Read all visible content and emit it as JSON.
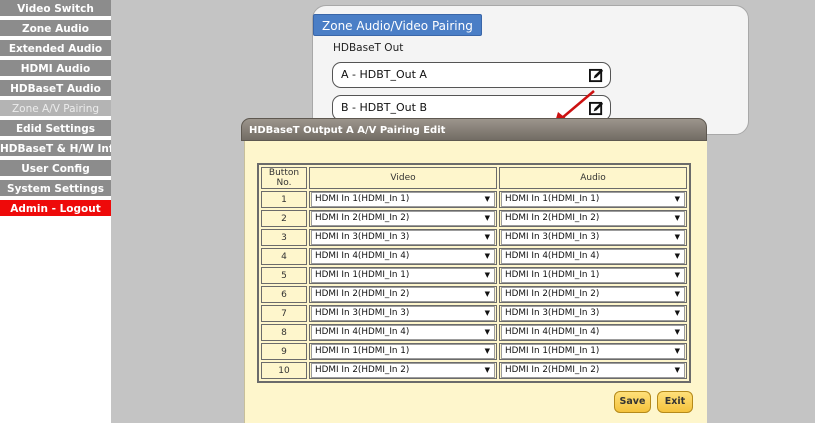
{
  "sidebar": {
    "items": [
      {
        "label": "Video Switch",
        "state": "normal"
      },
      {
        "label": "Zone Audio",
        "state": "normal"
      },
      {
        "label": "Extended Audio",
        "state": "normal"
      },
      {
        "label": "HDMI Audio",
        "state": "normal"
      },
      {
        "label": "HDBaseT Audio",
        "state": "normal"
      },
      {
        "label": "Zone A/V Pairing",
        "state": "active"
      },
      {
        "label": "Edid Settings",
        "state": "normal"
      },
      {
        "label": "HDBaseT & H/W Info",
        "state": "normal"
      },
      {
        "label": "User Config",
        "state": "normal"
      },
      {
        "label": "System Settings",
        "state": "normal"
      },
      {
        "label": "Admin - Logout",
        "state": "logout"
      }
    ]
  },
  "zone": {
    "title": "Zone Audio/Video Pairing",
    "subtitle": "HDBaseT Out",
    "outputs": [
      {
        "label": "A - HDBT_Out A",
        "icon": "edit-icon"
      },
      {
        "label": "B - HDBT_Out B",
        "icon": "edit-icon"
      }
    ]
  },
  "dialog": {
    "title": "HDBaseT Output A A/V Pairing Edit",
    "columns": {
      "button_no": "Button No.",
      "video": "Video",
      "audio": "Audio"
    },
    "rows": [
      {
        "no": "1",
        "video": "HDMI In 1(HDMI_In 1)",
        "audio": "HDMI In 1(HDMI_In 1)"
      },
      {
        "no": "2",
        "video": "HDMI In 2(HDMI_In 2)",
        "audio": "HDMI In 2(HDMI_In 2)"
      },
      {
        "no": "3",
        "video": "HDMI In 3(HDMI_In 3)",
        "audio": "HDMI In 3(HDMI_In 3)"
      },
      {
        "no": "4",
        "video": "HDMI In 4(HDMI_In 4)",
        "audio": "HDMI In 4(HDMI_In 4)"
      },
      {
        "no": "5",
        "video": "HDMI In 1(HDMI_In 1)",
        "audio": "HDMI In 1(HDMI_In 1)"
      },
      {
        "no": "6",
        "video": "HDMI In 2(HDMI_In 2)",
        "audio": "HDMI In 2(HDMI_In 2)"
      },
      {
        "no": "7",
        "video": "HDMI In 3(HDMI_In 3)",
        "audio": "HDMI In 3(HDMI_In 3)"
      },
      {
        "no": "8",
        "video": "HDMI In 4(HDMI_In 4)",
        "audio": "HDMI In 4(HDMI_In 4)"
      },
      {
        "no": "9",
        "video": "HDMI In 1(HDMI_In 1)",
        "audio": "HDMI In 1(HDMI_In 1)"
      },
      {
        "no": "10",
        "video": "HDMI In 2(HDMI_In 2)",
        "audio": "HDMI In 2(HDMI_In 2)"
      }
    ],
    "save_label": "Save",
    "exit_label": "Exit"
  },
  "colors": {
    "sidebar_bg": "#8c8c8c",
    "sidebar_active": "#b4b4b4",
    "logout_bg": "#ee0a0a",
    "title_blue": "#4a7ec6",
    "dialog_body": "#fef6cc",
    "button_yellow": "#f4c23c",
    "arrow_red": "#cc1111"
  }
}
